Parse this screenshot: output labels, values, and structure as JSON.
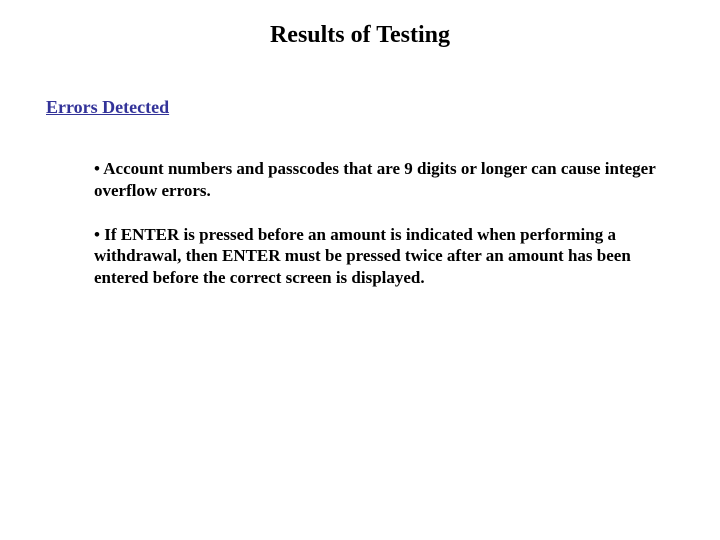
{
  "title": "Results of Testing",
  "subtitle": "Errors Detected",
  "bullets": [
    "• Account numbers and passcodes that are 9 digits or longer can cause integer overflow errors.",
    "• If ENTER is pressed before an amount is indicated when performing a withdrawal, then ENTER must be pressed twice after an amount has been entered before the correct screen is displayed."
  ],
  "colors": {
    "subtitle": "#333399"
  }
}
